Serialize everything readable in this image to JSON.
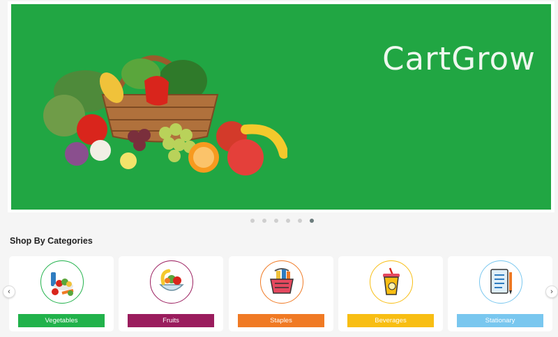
{
  "banner": {
    "brand": "CartGrow",
    "background": "#21a643",
    "slide_count": 6,
    "active_slide": 6
  },
  "section": {
    "title": "Shop By Categories"
  },
  "categories": [
    {
      "label": "Vegetables",
      "color": "#21b24b",
      "icon": "vegetables-icon"
    },
    {
      "label": "Fruits",
      "color": "#9a1c5d",
      "icon": "fruits-icon"
    },
    {
      "label": "Staples",
      "color": "#f07a24",
      "icon": "staples-icon"
    },
    {
      "label": "Beverages",
      "color": "#f8be13",
      "icon": "beverages-icon"
    },
    {
      "label": "Stationary",
      "color": "#79c7ef",
      "icon": "stationary-icon"
    }
  ],
  "nav": {
    "prev_icon": "chevron-left-icon",
    "next_icon": "chevron-right-icon"
  }
}
